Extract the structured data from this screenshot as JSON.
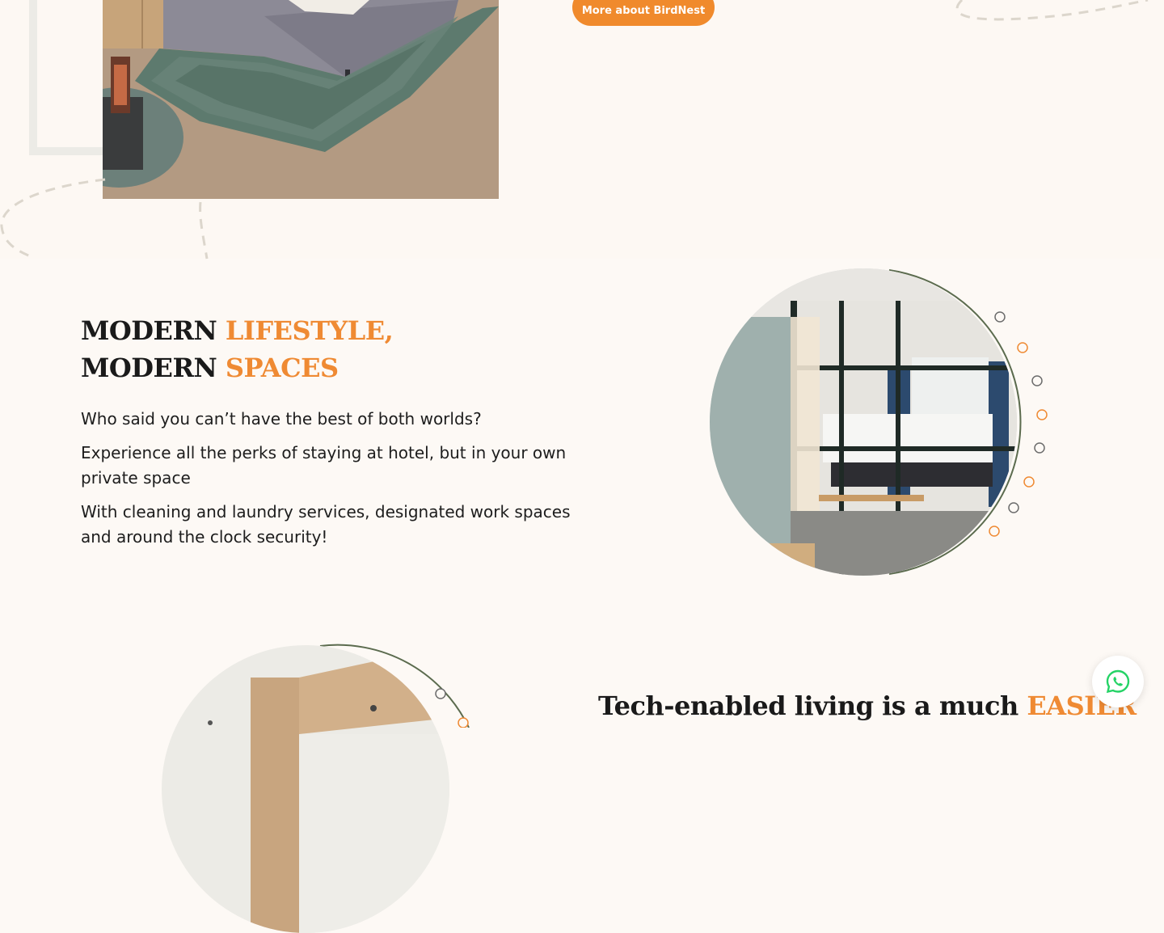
{
  "about": {
    "cta_label": "More about BirdNest"
  },
  "lifestyle": {
    "heading_line1_dark": "MODERN ",
    "heading_line1_accent": "LIFESTYLE,",
    "heading_line2_dark": "MODERN ",
    "heading_line2_accent": "SPACES",
    "paragraphs": [
      "Who said you can’t have the best of both worlds?",
      "Experience all the perks of staying at hotel, but in your own private space",
      "With cleaning and laundry services, designated work spaces and around the clock security!"
    ]
  },
  "tech": {
    "heading_dark": "Tech-enabled living is a much ",
    "heading_accent": "EASIER"
  },
  "colors": {
    "accent": "#ef8a33",
    "background": "#fdf9f5",
    "arc_green": "#5b6b4e",
    "whatsapp_green": "#25d366"
  },
  "icons": {
    "whatsapp": "whatsapp-icon"
  }
}
